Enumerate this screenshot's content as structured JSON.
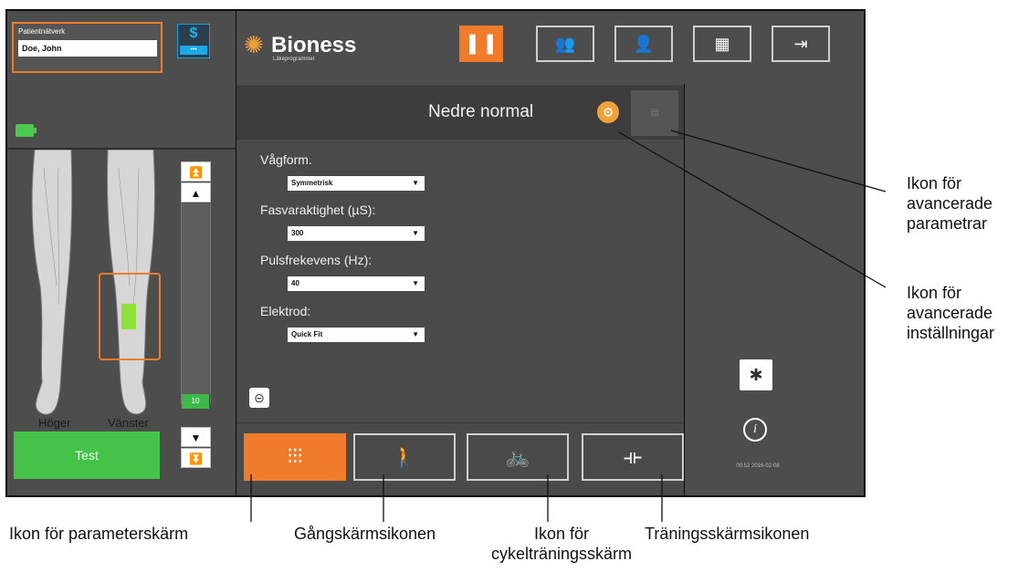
{
  "colors": {
    "accent": "#f07c2b",
    "test_green": "#44c24a",
    "panel": "#4d4d4d",
    "stim_blue": "#1aa0d8"
  },
  "patient": {
    "label": "Patientnätverk",
    "name": "Doe, John"
  },
  "stim_badge": {
    "icon": "dollar-stim-icon",
    "glyph": "$",
    "dots": "•••"
  },
  "legs": {
    "right_label": "Höger",
    "left_label": "Vänster"
  },
  "intensity": {
    "value": "10",
    "fill_fraction": 0.05
  },
  "test_button": {
    "label": "Test"
  },
  "logo": {
    "text": "Bioness",
    "sub": "Läkeprogrammet"
  },
  "nav": [
    {
      "name": "params",
      "icon": "legs-icon",
      "glyph": "▌▐"
    },
    {
      "name": "group",
      "icon": "group-icon",
      "glyph": "👥"
    },
    {
      "name": "user",
      "icon": "user-icon",
      "glyph": "👤"
    },
    {
      "name": "report",
      "icon": "report-icon",
      "glyph": "▦"
    },
    {
      "name": "exit",
      "icon": "exit-icon",
      "glyph": "⇥"
    }
  ],
  "program": {
    "title": "Nedre normal"
  },
  "fields": {
    "waveform": {
      "label": "Vågform.",
      "value": "Symmetrisk"
    },
    "duration": {
      "label": "Fasvaraktighet (µS):",
      "value": "300"
    },
    "frequency": {
      "label": "Pulsfrekevens (Hz):",
      "value": "40"
    },
    "electrode": {
      "label": "Elektrod:",
      "value": "Quick Fit"
    }
  },
  "tabs": [
    {
      "name": "params",
      "icon": "sliders-icon",
      "glyph": "⫶⫶⫶"
    },
    {
      "name": "walk",
      "icon": "walking-icon",
      "glyph": "🚶"
    },
    {
      "name": "cycle",
      "icon": "cycle-icon",
      "glyph": "🚲"
    },
    {
      "name": "train",
      "icon": "dumbbell-icon",
      "glyph": "⟛"
    }
  ],
  "timestamp": "00:52 2016-02-08",
  "callouts": {
    "adv_params": "Ikon för avancerade parametrar",
    "adv_settings": "Ikon för avancerade inställningar",
    "params": "Ikon för parameterskärm",
    "walk": "Gångskärmsikonen",
    "cycle": "Ikon för cykelträningsskärm",
    "train": "Träningsskärmsikonen"
  }
}
